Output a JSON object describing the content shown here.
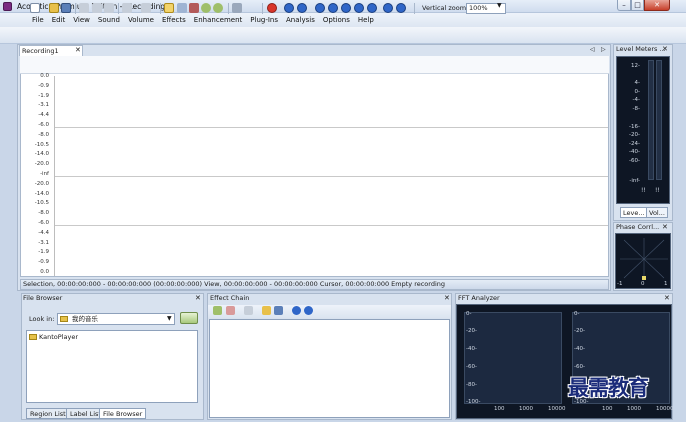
{
  "window": {
    "title": "Acoustica Premium Edition - [Recording1]",
    "minimize": "–",
    "maximize": "□",
    "close": "✕"
  },
  "menu": [
    "File",
    "Edit",
    "View",
    "Sound",
    "Volume",
    "Effects",
    "Enhancement",
    "Plug-Ins",
    "Analysis",
    "Options",
    "Help"
  ],
  "toolbar": {
    "vertical_zoom_label": "Vertical zoom:",
    "vertical_zoom_value": "100%"
  },
  "document": {
    "tab_label": "Recording1",
    "tab_close": "✕",
    "nav_left": "◁",
    "nav_right": "▷",
    "y_labels_top": [
      "0.0",
      "-0.9",
      "-1.9",
      "-3.1",
      "-4.4",
      "-6.0",
      "-8.0",
      "-10.5",
      "-14.0",
      "-20.0",
      "-inf"
    ],
    "y_labels_bottom": [
      "-20.0",
      "-14.0",
      "-10.5",
      "-8.0",
      "-6.0",
      "-4.4",
      "-3.1",
      "-1.9",
      "-0.9",
      "0.0"
    ],
    "status": "Selection, 00:00:00:000 - 00:00:00:000 (00:00:00:000)  View, 00:00:00:000 - 00:00:00:000  Cursor, 00:00:00:000   Empty recording"
  },
  "level_meters": {
    "title": "Level Meters ...",
    "close": "✕",
    "scale": [
      "12-",
      "4-",
      "0-",
      "-4-",
      "-8-",
      "-16-",
      "-20-",
      "-24-",
      "-40-",
      "-60-",
      "-inf-"
    ],
    "tabs": [
      "Leve...",
      "Vol..."
    ],
    "peak_left": "!!",
    "peak_right": "!!"
  },
  "phase_correlation": {
    "title": "Phase Corrl...",
    "close": "✕",
    "scale": [
      "-1",
      "0",
      "1"
    ]
  },
  "file_browser": {
    "title": "File Browser",
    "close": "✕",
    "look_in_label": "Look in:",
    "look_in_value": "我的音乐",
    "items": [
      "KantoPlayer"
    ],
    "tabs": [
      "Region List",
      "Label List",
      "File Browser"
    ]
  },
  "effect_chain": {
    "title": "Effect Chain",
    "close": "✕"
  },
  "fft_analyzer": {
    "title": "FFT Analyzer",
    "close": "✕",
    "y_scale": [
      "0-",
      "-20-",
      "-40-",
      "-60-",
      "-80-",
      "-100-"
    ],
    "x_scale": [
      "100",
      "1000",
      "10000"
    ]
  },
  "watermark": "最需教育",
  "colors": {
    "accent": "#1a2b7a",
    "meter_bg": "#0e1624",
    "record_red": "#d9352a",
    "transport_blue": "#2f66c8"
  }
}
